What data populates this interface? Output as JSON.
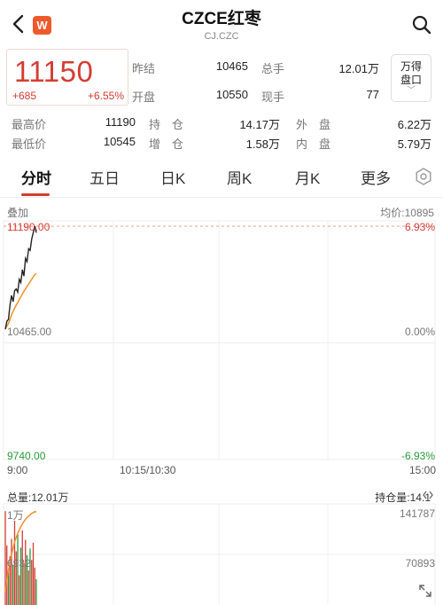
{
  "header": {
    "title": "CZCE红枣",
    "subtitle": "CJ.CZC",
    "logo_text": "W",
    "icons": {
      "back": "chevron-left-icon",
      "search": "search-icon",
      "logo": "wind-logo-icon"
    }
  },
  "quote": {
    "price": "11150",
    "change": "+685",
    "change_pct": "+6.55%",
    "prev_settle_label": "昨结",
    "prev_settle": "10465",
    "total_vol_label": "总手",
    "total_vol": "12.01万",
    "open_label": "开盘",
    "open": "10550",
    "now_vol_label": "现手",
    "now_vol": "77",
    "wande_line1": "万得",
    "wande_line2": "盘口"
  },
  "stats": [
    {
      "label": "最高价",
      "value": "11190",
      "label2": "持　仓",
      "value2": "14.17万",
      "label3": "外　盘",
      "value3": "6.22万"
    },
    {
      "label": "最低价",
      "value": "10545",
      "label2": "增　仓",
      "value2": "1.58万",
      "label3": "内　盘",
      "value3": "5.79万"
    }
  ],
  "tabs": [
    {
      "label": "分时",
      "active": true
    },
    {
      "label": "五日",
      "active": false
    },
    {
      "label": "日K",
      "active": false
    },
    {
      "label": "周K",
      "active": false
    },
    {
      "label": "月K",
      "active": false
    },
    {
      "label": "更多",
      "active": false
    }
  ],
  "chart": {
    "overlay_label": "叠加",
    "avg_label": "均价:10895",
    "axis_top": "11190.00",
    "axis_mid": "10465.00",
    "axis_bot": "9740.00",
    "pct_top": "6.93%",
    "pct_mid": "0.00%",
    "pct_bot": "-6.93%",
    "time_start": "9:00",
    "time_mid": "10:15/10:30",
    "time_end": "15:00",
    "vol_total": "总量:12.01万",
    "oi_label": "持仓量:14.1",
    "vol_axis_top": "1万",
    "vol_axis_mid": "6932",
    "oi_axis_top": "141787",
    "oi_axis_mid": "70893",
    "colors": {
      "up": "#d43c33",
      "down": "#2a9a3a",
      "price_line": "#222222",
      "avg_line": "#f0902a"
    },
    "price_series": [
      10550,
      10600,
      10610,
      10700,
      10760,
      10720,
      10790,
      10800,
      10780,
      10860,
      10840,
      10920,
      10880,
      10990,
      10970,
      11050,
      11040,
      11110,
      11150,
      11190,
      11150
    ],
    "avg_series": [
      10550,
      10570,
      10585,
      10610,
      10640,
      10660,
      10680,
      10700,
      10715,
      10735,
      10750,
      10770,
      10785,
      10800,
      10815,
      10830,
      10845,
      10860,
      10875,
      10890,
      10895
    ],
    "volume_series": [
      9800,
      6200,
      3400,
      5100,
      6900,
      4200,
      8800,
      5600,
      7400,
      3100,
      6000,
      7800,
      4400,
      6800,
      5200,
      3600,
      5900,
      4700,
      6500,
      3900,
      2700
    ],
    "volume_up": [
      true,
      true,
      false,
      true,
      true,
      false,
      true,
      true,
      false,
      true,
      false,
      true,
      false,
      true,
      false,
      true,
      false,
      true,
      true,
      true,
      false
    ],
    "oi_series": [
      20000,
      38000,
      52000,
      64000,
      76000,
      86000,
      95000,
      102000,
      108000,
      113000,
      118000,
      122000,
      126000,
      129000,
      132000,
      134000,
      136000,
      138000,
      139500,
      140500,
      141000
    ]
  }
}
